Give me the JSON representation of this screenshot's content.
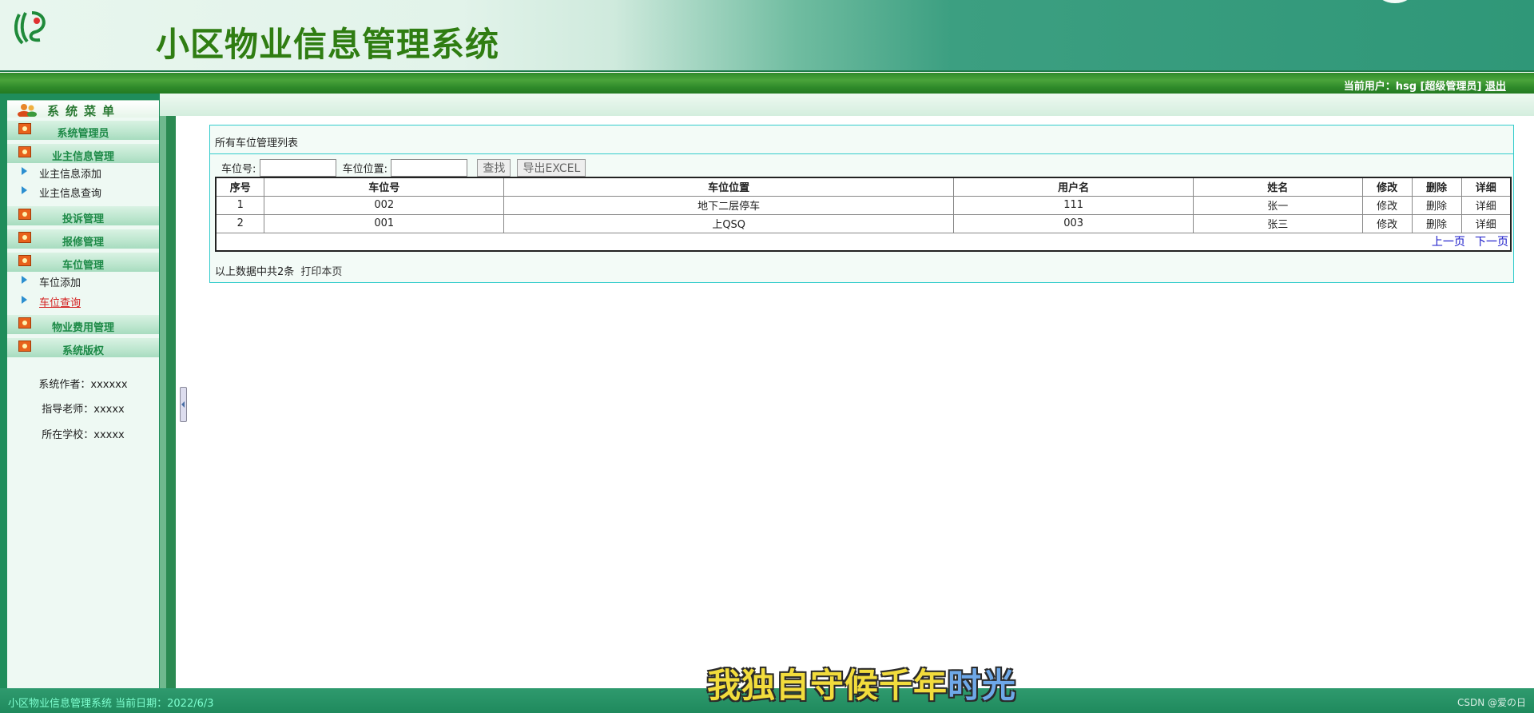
{
  "header": {
    "title": "小区物业信息管理系统",
    "user_prefix": "当前用户：hsg [超级管理员]",
    "logout": "退出"
  },
  "sidebar": {
    "menu_title": "系统菜单",
    "groups": [
      {
        "label": "系统管理员"
      },
      {
        "label": "业主信息管理"
      },
      {
        "label": "投诉管理"
      },
      {
        "label": "报修管理"
      },
      {
        "label": "车位管理"
      },
      {
        "label": "物业费用管理"
      },
      {
        "label": "系统版权"
      }
    ],
    "items": [
      {
        "label": "业主信息添加"
      },
      {
        "label": "业主信息查询"
      },
      {
        "label": "车位添加"
      },
      {
        "label": "车位查询"
      }
    ],
    "info": [
      "系统作者：xxxxxx",
      "指导老师：xxxxx",
      "所在学校：xxxxx"
    ]
  },
  "main": {
    "panel_title": "所有车位管理列表",
    "search": {
      "slot_no_label": "车位号:",
      "slot_loc_label": "车位位置:",
      "slot_no_value": "",
      "slot_loc_value": "",
      "find_button": "查找",
      "export_button": "导出EXCEL"
    },
    "table": {
      "headers": [
        "序号",
        "车位号",
        "车位位置",
        "用户名",
        "姓名",
        "修改",
        "删除",
        "详细"
      ],
      "rows": [
        [
          "1",
          "002",
          "地下二层停车",
          "111",
          "张一",
          "修改",
          "删除",
          "详细"
        ],
        [
          "2",
          "001",
          "上QSQ",
          "003",
          "张三",
          "修改",
          "删除",
          "详细"
        ]
      ]
    },
    "pager": {
      "prev": "上一页",
      "next": "下一页"
    },
    "summary": "以上数据中共2条",
    "print": "打印本页"
  },
  "status_bar": {
    "text": "小区物业信息管理系统 当前日期：2022/6/3",
    "watermark": "CSDN @爱の日"
  },
  "overlay_caption": {
    "main": "我独自守候千年",
    "tail": "时光"
  },
  "colors": {
    "brand_green": "#2f7d12",
    "sidebar_green": "#1f8d5b",
    "accent_cyan": "#33cccc",
    "link_blue": "#1515c8",
    "active_red": "#d42020"
  }
}
